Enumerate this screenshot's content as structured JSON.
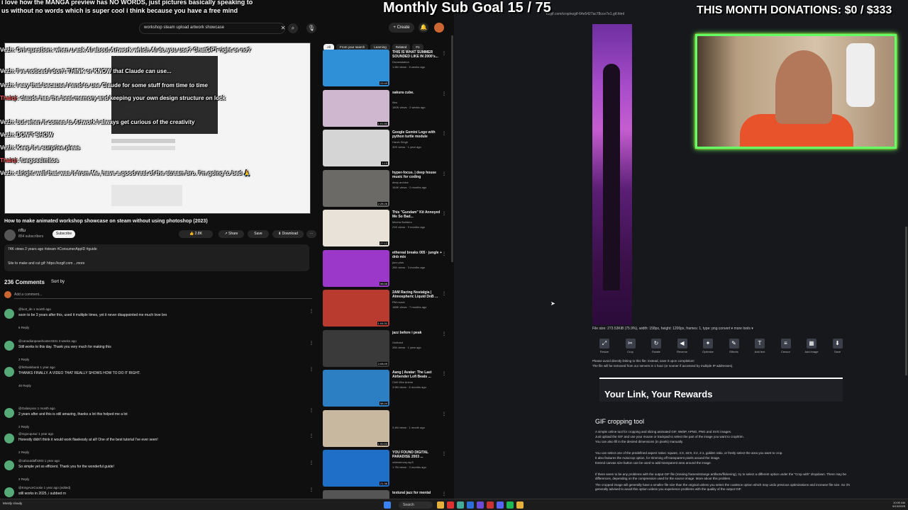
{
  "overlay": {
    "goal": "Monthly Sub Goal 15 / 75",
    "donations": "THIS MONTH DONATIONS: $0 / $333",
    "top_message": "i love how the MANGA preview has NO WORDS, just pictures basically speaking to us without no words which is super cool i think because you have a free mind",
    "chat": [
      {
        "name": "Vezh",
        "text": ": Oni question: when u ask AI about Artwork which AI do you use? ChatGPT right or no?"
      },
      {
        "name": "Vezh",
        "text": ": I've noticed I don't THINK or KNOW that Claude can use..."
      },
      {
        "name": "Vezh",
        "text": ": I say that because I tend to use Claude for some stuff from time to time"
      },
      {
        "name": "Thaiqi",
        "text": ": claude has the best memory and keeping your own design structure on lock"
      },
      {
        "name": "Vezh",
        "text": ": but when it comes to Artwork I always get curious of the creativity"
      },
      {
        "name": "Vezh",
        "text": ": DON'T SHOW"
      },
      {
        "name": "Vezh",
        "text": ": Keep it a surprise pleas"
      },
      {
        "name": "Thaiqi",
        "text": ": fuegossimitos"
      },
      {
        "name": "Vezh",
        "text": ": alright well that was it from Me, have a good rest of the stream bro. I'm going to bed 🙏"
      }
    ]
  },
  "youtube": {
    "search_value": "workshop steam upload artwork showcase",
    "create_label": "+ Create",
    "video_title": "How to make animated workshop showcase on steam without using photoshop (2023)",
    "channel": "nftu",
    "channel_subs": "854 subscribers",
    "subscribe": "Subscribe",
    "likes": "👍 2.8K",
    "share": "↗ Share",
    "save": "Save",
    "download": "⬇ Download",
    "desc_line1": "74K views  2 years ago  #steam #ConsumerAppID #guide",
    "desc_line2": "Site to make and cut gif: https://ezgif.com  ...more",
    "comments_count": "236 Comments",
    "sort_by": "Sort by",
    "add_comment": "Add a comment...",
    "comments": [
      {
        "user": "@bo3_de  1 month ago",
        "text": "soon to be 3 years after this, used it multiple times, yet it never disappointed me much love bro",
        "meta": "6  Reply"
      },
      {
        "user": "@canadianpeashooter4331  3 weeks ago",
        "text": "Still works to this day. Thank you very much for making this",
        "meta": "2  Reply"
      },
      {
        "user": "@fethankbank  1 year ago",
        "text": "THANKS FINALLY. A VIDEO THAT REALLY SHOWS HOW TO DO IT RIGHT.",
        "meta": "46  Reply"
      },
      {
        "user": "@Galaxyxxx  1 month ago",
        "text": "2 years after and this is still amazing, thanks a lot this helped me a lot",
        "meta": "2  Reply"
      },
      {
        "user": "@mgocqusur  1 year ago",
        "text": "Honestly didn't think it would work flawlessly at all! One of the best tutorial I've ever seen!",
        "meta": "2  Reply"
      },
      {
        "user": "@cahoutdaff4303  1 year ago",
        "text": "So simple yet so efficient. Thank you for the wonderful guide!",
        "meta": "2  Reply"
      },
      {
        "user": "@KingAceCooke  1 year ago (edited)",
        "text": "still works in 2025, i subbed rn",
        "meta": ""
      }
    ],
    "chips": [
      "All",
      "From your search",
      "Learning",
      "Related",
      "Fo"
    ],
    "related": [
      {
        "title": "THIS IS WHAT SUMMER SOUNDED LIKE IN 2000's...",
        "channel": "Dreamstation",
        "meta": "1.5M views · 8 weeks ago",
        "dur": "22:00",
        "color": "#2f8fd7"
      },
      {
        "title": "sakura cube.",
        "channel": "lilou",
        "meta": "180K views · 2 weeks ago",
        "dur": "1:01:50",
        "color": "#cfb7d0"
      },
      {
        "title": "Google Gemini Logo with python turtle module",
        "channel": "Harsh Singh",
        "meta": "32K views · 1 year ago",
        "dur": "1:15",
        "color": "#d5d5d5"
      },
      {
        "title": "hyper-focus. | deep house music for coding",
        "channel": "deep archive",
        "meta": "164K views · 2 months ago",
        "dur": "2:28:26",
        "color": "#6b6a66"
      },
      {
        "title": "This \"Gundam\" Kit Annoyed Me So Bad...",
        "channel": "Mecha Builders",
        "meta": "21K views · 9 months ago",
        "dur": "27:12",
        "color": "#e8e2d8"
      },
      {
        "title": "ethereal breaks 005 · jungle + dnb mix",
        "channel": "juno plus",
        "meta": "28K views · 3 months ago",
        "dur": "58:56",
        "color": "#9b38c9"
      },
      {
        "title": "2AM Racing Nostalgia | Atmospheric Liquid DnB ...",
        "channel": "RM.music",
        "meta": "188K views · 7 months ago",
        "dur": "1:04:31",
        "color": "#b93a2e"
      },
      {
        "title": "jazz before i peak",
        "channel": "Outfunct",
        "meta": "28K views · 1 year ago",
        "dur": "2:08:09",
        "color": "#3a3a3a"
      },
      {
        "title": "Aang | Avatar: The Last Airbender Lofi Beats ...",
        "channel": "Chill Vibe Anime",
        "meta": "3.5M views · 6 months ago",
        "dur": "58:24",
        "color": "#2b7fc2"
      },
      {
        "title": "",
        "channel": "",
        "meta": "3.4M views · 1 month ago",
        "dur": "1:00:53",
        "color": "#c9b8a0"
      },
      {
        "title": "YOU FOUND DIGITAL PARADISE 2003 ...",
        "channel": "oddmemory.mp3",
        "meta": "1.7M views · 3 months ago",
        "dur": "21:36",
        "color": "#1f6fc8"
      },
      {
        "title": "textural jazz for mental",
        "channel": "",
        "meta": "",
        "dur": "",
        "color": "#555"
      }
    ]
  },
  "ezgif": {
    "url": "ezgif.com/crop/ezgif-64e5427ac78cce7e1.gif.html",
    "file_info": "File size: 273.53KiB (75.9%), width: 158px, height: 1200px, frames: 1, type: png   convert ▾   more tools ▾",
    "tools": [
      {
        "icon": "⤢",
        "label": "Resize"
      },
      {
        "icon": "✂",
        "label": "Crop"
      },
      {
        "icon": "↻",
        "label": "Rotate"
      },
      {
        "icon": "◀",
        "label": "Reverse"
      },
      {
        "icon": "✦",
        "label": "Optimize"
      },
      {
        "icon": "✎",
        "label": "Effects"
      },
      {
        "icon": "T",
        "label": "Add text"
      },
      {
        "icon": "≡",
        "label": "Censor"
      },
      {
        "icon": "▦",
        "label": "Add image"
      },
      {
        "icon": "⬇",
        "label": "Save"
      }
    ],
    "notice1": "Please avoid directly linking to this file: instead, save it upon completion!",
    "notice2": "The file will be removed from our servers in 1 hour (or sooner if accessed by multiple IP addresses).",
    "ad_title": "Your Link, Your Rewards",
    "heading": "GIF cropping tool",
    "paragraphs": [
      "A simple online tool for cropping and slicing animated GIF, WebP, APNG, PNG and SVG images.",
      "Just upload the GIF and use your mouse or trackpad to select the part of the image you want to crop/trim.",
      "You can also fill in the desired dimensions (in pixels) manually.",
      "You can select one of the predefined aspect ratios: square, 4:3, 16:9, 3:2, 2:1, golden ratio, or freely select the area you want to crop.",
      "It also features the Autocrop option, for trimming off transparent pixels around the image.",
      "Extend canvas size button can be used to add transparent area around the image.",
      "If there seem to be any problems with the output GIF file (missing frames/strange artifacts/flickering), try to select a different option under the \"Crop with\" dropdown. There may be differences, depending on the compression used for the source image. More about this problem.",
      "The cropped image will generally have a smaller file size than the original unless you select the coalesce option which may undo previous optimizations and increase file size. So it's generally advised to avoid this option unless you experience problems with the quality of the output GIF."
    ]
  },
  "taskbar": {
    "search": "Search",
    "weather": "Mostly cloudy",
    "time": "10:00 AM 6/10/2025"
  }
}
